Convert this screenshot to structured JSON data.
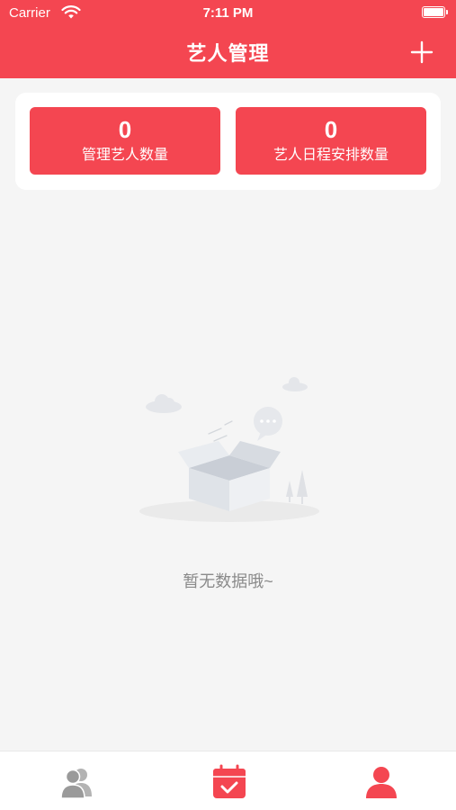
{
  "status_bar": {
    "carrier": "Carrier",
    "time": "7:11 PM"
  },
  "nav": {
    "title": "艺人管理"
  },
  "stats": [
    {
      "value": "0",
      "label": "管理艺人数量"
    },
    {
      "value": "0",
      "label": "艺人日程安排数量"
    }
  ],
  "empty_state": {
    "message": "暂无数据哦~"
  },
  "colors": {
    "brand": "#f44651",
    "background": "#f5f5f5",
    "inactive": "#9a9a9a"
  },
  "tabbar": {
    "items": [
      {
        "icon": "users-icon",
        "active": false
      },
      {
        "icon": "calendar-check-icon",
        "active": true
      },
      {
        "icon": "person-icon",
        "active": true
      }
    ]
  }
}
